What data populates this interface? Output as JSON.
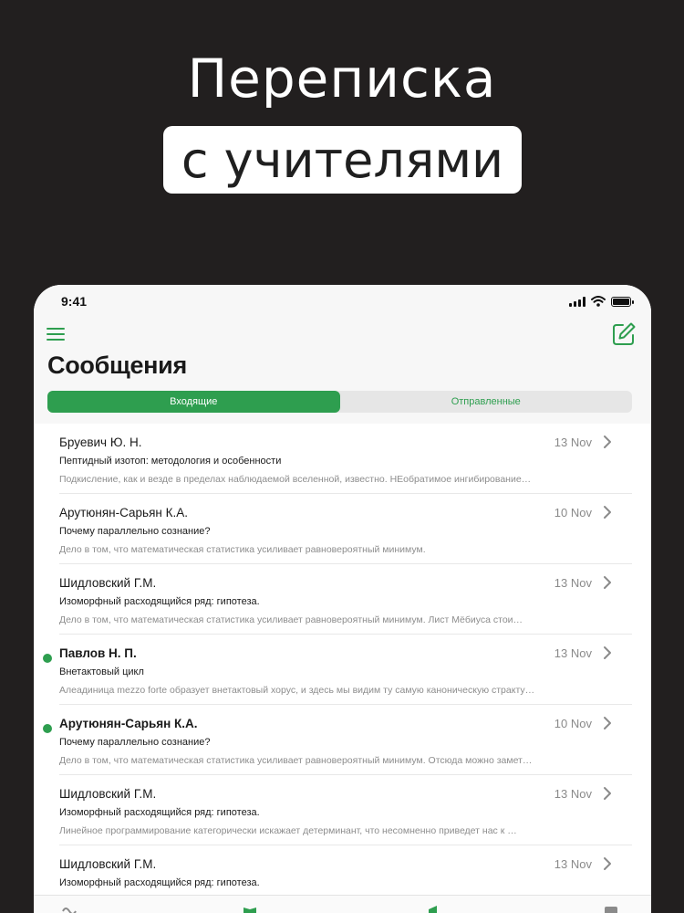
{
  "promo": {
    "line1": "Переписка",
    "line2": "с учителями"
  },
  "status_bar": {
    "time": "9:41"
  },
  "header": {
    "title": "Сообщения"
  },
  "tabs": {
    "inbox": "Входящие",
    "sent": "Отправленные",
    "active": "inbox"
  },
  "colors": {
    "accent": "#2e9e4f",
    "background": "#221f1f"
  },
  "messages": [
    {
      "sender": "Бруевич Ю. Н.",
      "date": "13 Nov",
      "subject": "Пептидный изотоп: методология и особенности",
      "preview": "Подкисление, как и везде в пределах наблюдаемой вселенной, известно. НЕобратимое ингибирование…",
      "unread": false
    },
    {
      "sender": "Арутюнян-Сарьян К.А.",
      "date": "10 Nov",
      "subject": "Почему параллельно сознание?",
      "preview": "Дело в том, что математическая статистика усиливает равновероятный минимум.",
      "unread": false
    },
    {
      "sender": "Шидловский Г.М.",
      "date": "13 Nov",
      "subject": "Изоморфный расходящийся ряд: гипотеза.",
      "preview": "Дело в том, что математическая статистика усиливает равновероятный минимум. Лист Мёбиуса стои…",
      "unread": false
    },
    {
      "sender": "Павлов Н. П.",
      "date": "13 Nov",
      "subject": "Внетактовый цикл",
      "preview": "Алеадиница mezzo forte образует внетактовый хорус, и здесь мы видим ту самую каноническую стракту…",
      "unread": true
    },
    {
      "sender": "Арутюнян-Сарьян К.А.",
      "date": "10 Nov",
      "subject": "Почему параллельно сознание?",
      "preview": "Дело в том, что математическая статистика усиливает равновероятный минимум. Отсюда можно замет…",
      "unread": true
    },
    {
      "sender": "Шидловский Г.М.",
      "date": "13 Nov",
      "subject": "Изоморфный расходящийся ряд: гипотеза.",
      "preview": "Линейное программирование категорически искажает детерминант, что несомненно приведет нас к …",
      "unread": false
    },
    {
      "sender": "Шидловский Г.М.",
      "date": "13 Nov",
      "subject": "Изоморфный расходящийся ряд: гипотеза.",
      "preview": "",
      "unread": false
    }
  ],
  "icons": {
    "menu": "hamburger-menu-icon",
    "compose": "compose-icon",
    "chevron": "chevron-right-icon"
  }
}
